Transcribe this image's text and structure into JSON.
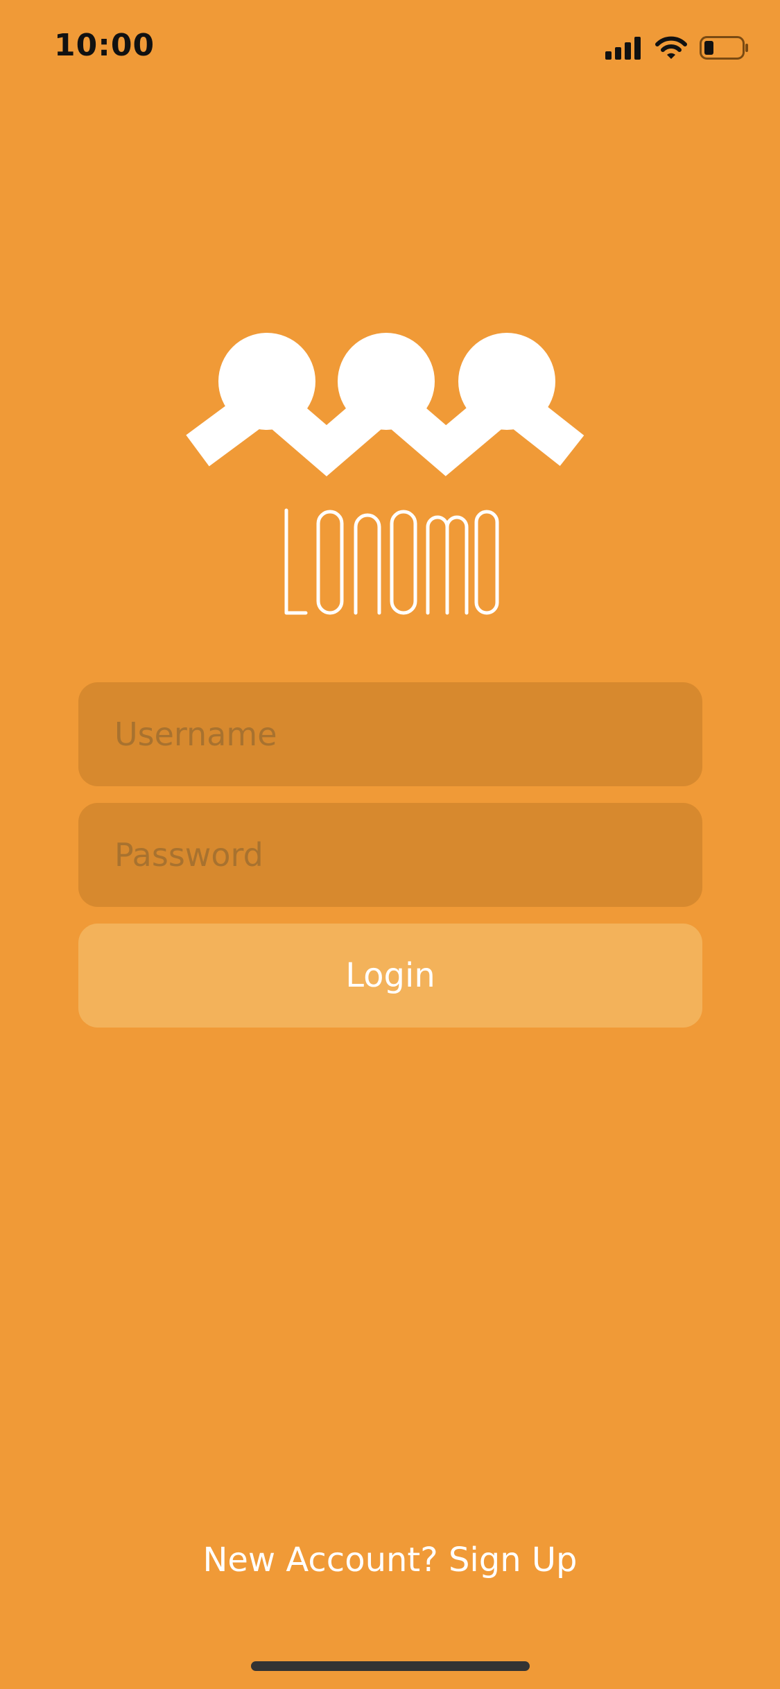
{
  "status_bar": {
    "time": "10:00",
    "icons": [
      "cellular-signal-icon",
      "wifi-icon",
      "battery-icon"
    ]
  },
  "logo": {
    "name": "Lonomo",
    "wordmark": "LONOMO"
  },
  "form": {
    "username_placeholder": "Username",
    "password_placeholder": "Password",
    "login_label": "Login"
  },
  "footer": {
    "signup_text": "New Account? Sign Up"
  },
  "colors": {
    "background": "#F09A37",
    "field_background": "#D7892E",
    "button_background": "#F3B25A",
    "text_white": "#FFFFFF"
  }
}
